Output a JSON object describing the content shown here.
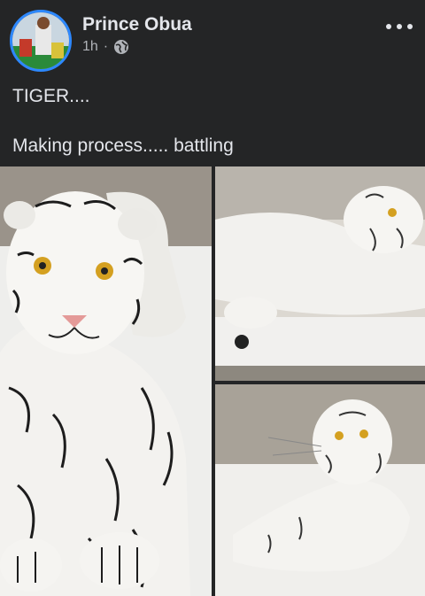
{
  "post": {
    "author": "Prince Obua",
    "time": "1h",
    "separator": "·",
    "privacy_icon": "globe-icon",
    "more_icon": "more-horizontal-icon",
    "text": "TIGER....\n\nMaking process..... battling"
  },
  "photos": [
    {
      "name": "tiger-cake-front-view"
    },
    {
      "name": "tiger-cake-side-view"
    },
    {
      "name": "tiger-cake-reclining-view"
    }
  ],
  "colors": {
    "background": "#242526",
    "text": "#e4e6eb",
    "secondary_text": "#b0b3b8",
    "avatar_ring": "#2d88ff"
  }
}
